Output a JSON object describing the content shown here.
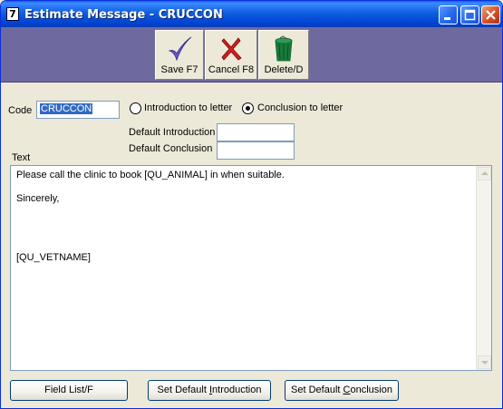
{
  "window": {
    "title": "Estimate Message - CRUCCON",
    "icon_glyph": "7"
  },
  "titlebar_buttons": {
    "minimize": "minimize-icon",
    "maximize": "maximize-icon",
    "close": "close-icon"
  },
  "toolbar": {
    "save_label": "Save F7",
    "cancel_label": "Cancel F8",
    "delete_label": "Delete/D"
  },
  "form": {
    "code_label": "Code",
    "code_value": "CRUCCON",
    "radio_intro_label": "Introduction to letter",
    "radio_conclusion_label": "Conclusion to letter",
    "selected_radio": "conclusion",
    "default_intro_label": "Default Introduction",
    "default_intro_value": "",
    "default_conclusion_label": "Default Conclusion",
    "default_conclusion_value": "",
    "text_label": "Text"
  },
  "text_lines": [
    "Please call the clinic to book [QU_ANIMAL] in when suitable.",
    "",
    "Sincerely,",
    "",
    "",
    "",
    "",
    "[QU_VETNAME]"
  ],
  "buttons": {
    "field_list": "Field List/F",
    "set_intro_pre": "Set Default ",
    "set_intro_u": "I",
    "set_intro_post": "ntroduction",
    "set_concl_pre": "Set Default ",
    "set_concl_u": "C",
    "set_concl_post": "onclusion"
  },
  "colors": {
    "title_bar": "#0054e3",
    "toolbar_bg": "#6e6aa0",
    "window_bg": "#ece9d8",
    "selection": "#316ac5"
  }
}
